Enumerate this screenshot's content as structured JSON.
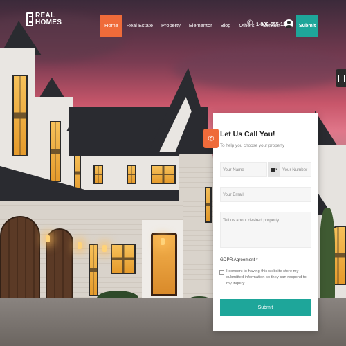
{
  "brand": {
    "line1": "REAL",
    "line2": "HOMES"
  },
  "nav": {
    "items": [
      {
        "label": "Home",
        "active": true
      },
      {
        "label": "Real Estate"
      },
      {
        "label": "Property"
      },
      {
        "label": "Elementor"
      },
      {
        "label": "Blog"
      },
      {
        "label": "Others"
      },
      {
        "label": "Contact"
      }
    ]
  },
  "header": {
    "phone": "1-800-555-1234",
    "submit_label": "Submit"
  },
  "form": {
    "title": "Let Us Call You!",
    "subtitle": "To help you choose your property",
    "name_placeholder": "Your Name",
    "number_placeholder": "Your Number",
    "email_placeholder": "Your Email",
    "message_placeholder": "Tell us about desired property",
    "gdpr_label": "GDPR Agreement *",
    "gdpr_text": "I consent to having this website store my submitted information so they can respond to my inquiry.",
    "submit_label": "Submit"
  },
  "colors": {
    "accent_orange": "#ef6b3a",
    "accent_teal": "#1ea69a"
  },
  "icons": {
    "phone": "phone-icon",
    "user": "user-icon",
    "form_badge": "phone-badge-icon",
    "side_tab": "side-panel-icon",
    "flag": "flag-icon"
  }
}
